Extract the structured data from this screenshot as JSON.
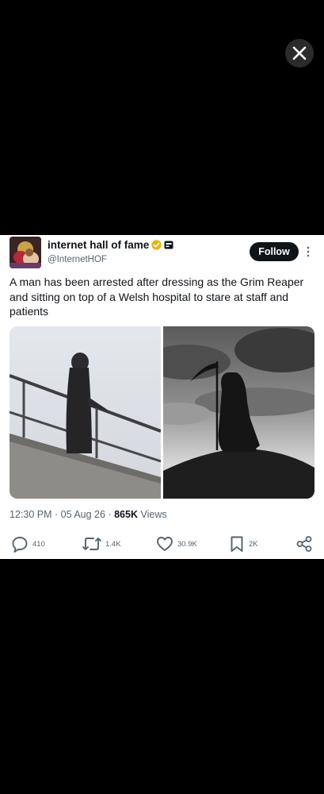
{
  "viewer": {
    "close_icon": "close-icon"
  },
  "tweet": {
    "display_name": "internet hall of fame",
    "handle": "@InternetHOF",
    "verified_icon": "verified-badge-icon",
    "affiliate_icon": "affiliate-badge-icon",
    "follow_label": "Follow",
    "text": "A man has been arrested after dressing as the Grim Reaper and sitting on top of a Welsh hospital to stare at staff and patients",
    "time": "12:30 PM",
    "sep1": "·",
    "date": "05 Aug 26",
    "sep2": "·",
    "views_count": "865K",
    "views_label": "Views",
    "replies": "410",
    "retweets": "1.4K",
    "likes": "30.9K",
    "bookmarks": "2K"
  },
  "colors": {
    "text": "#0f1419",
    "secondary": "#536471",
    "verified": "#e2b719"
  }
}
